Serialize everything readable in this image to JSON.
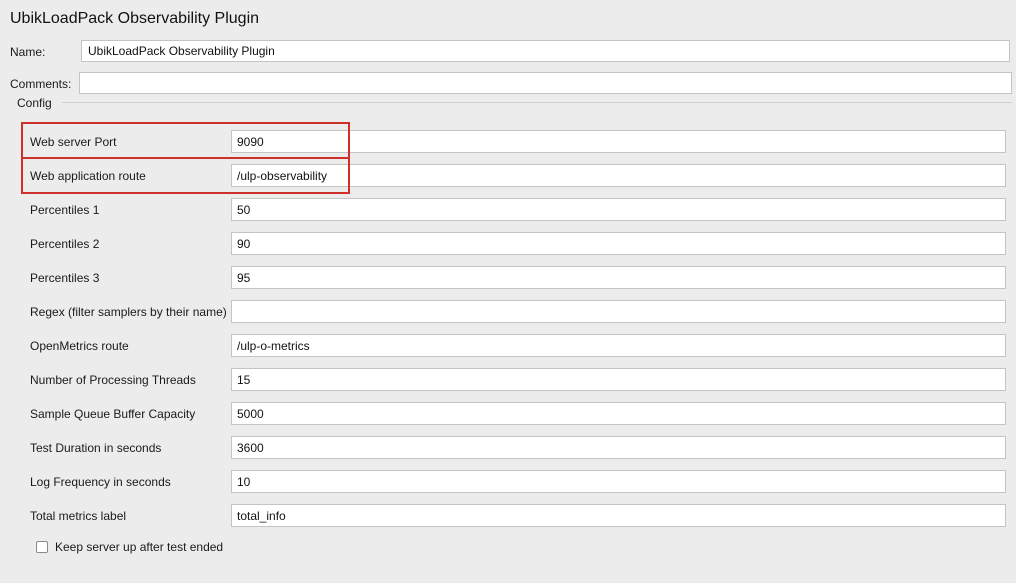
{
  "title": "UbikLoadPack Observability Plugin",
  "name_label": "Name:",
  "name_value": "UbikLoadPack Observability Plugin",
  "comments_label": "Comments:",
  "comments_value": "",
  "config_legend": "Config",
  "fields": [
    {
      "label": "Web server Port",
      "value": "9090"
    },
    {
      "label": "Web application route",
      "value": "/ulp-observability"
    },
    {
      "label": "Percentiles 1",
      "value": "50"
    },
    {
      "label": "Percentiles 2",
      "value": "90"
    },
    {
      "label": "Percentiles 3",
      "value": "95"
    },
    {
      "label": "Regex (filter samplers by their name)",
      "value": ""
    },
    {
      "label": "OpenMetrics route",
      "value": "/ulp-o-metrics"
    },
    {
      "label": "Number of Processing Threads",
      "value": "15"
    },
    {
      "label": "Sample Queue Buffer Capacity",
      "value": "5000"
    },
    {
      "label": "Test Duration in seconds",
      "value": "3600"
    },
    {
      "label": "Log Frequency in seconds",
      "value": "10"
    },
    {
      "label": "Total metrics label",
      "value": "total_info"
    }
  ],
  "checkbox_label": "Keep server up after test ended",
  "checkbox_checked": false,
  "highlight_color": "#d0302a"
}
